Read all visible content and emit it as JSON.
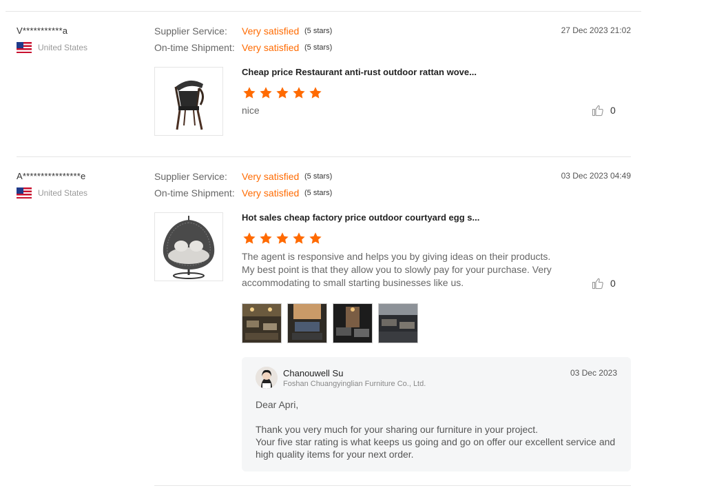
{
  "reviews": [
    {
      "user": "V***********a",
      "country": "United States",
      "date": "27 Dec 2023 21:02",
      "supplier_label": "Supplier Service:",
      "supplier_value": "Very satisfied",
      "supplier_stars": "(5 stars)",
      "shipment_label": "On-time Shipment:",
      "shipment_value": "Very satisfied",
      "shipment_stars": "(5 stars)",
      "product_title": "Cheap price Restaurant anti-rust outdoor rattan wove...",
      "rating": 5,
      "text": "nice",
      "likes": "0"
    },
    {
      "user": "A****************e",
      "country": "United States",
      "date": "03 Dec 2023 04:49",
      "supplier_label": "Supplier Service:",
      "supplier_value": "Very satisfied",
      "supplier_stars": "(5 stars)",
      "shipment_label": "On-time Shipment:",
      "shipment_value": "Very satisfied",
      "shipment_stars": "(5 stars)",
      "product_title": "Hot sales cheap factory price outdoor courtyard egg s...",
      "rating": 5,
      "text": "The agent is responsive and helps you by giving ideas on their products. My best point is that they allow you to slowly pay for your purchase. Very accommodating to small starting businesses like us.",
      "likes": "0",
      "reply": {
        "name": "Chanouwell Su",
        "company": "Foshan Chuangyinglian Furniture Co., Ltd.",
        "date": "03 Dec 2023",
        "body": "Dear Apri,\n\nThank you very much for your sharing our furniture in your project.\nYour five star rating is what keeps us going and go on offer our excellent service and high quality items for your next order."
      }
    }
  ],
  "colors": {
    "accent": "#ff6a00",
    "star": "#ff6a00"
  },
  "icons": {
    "like": "thumbs-up-icon",
    "flag": "us-flag-icon",
    "star": "star-icon"
  }
}
